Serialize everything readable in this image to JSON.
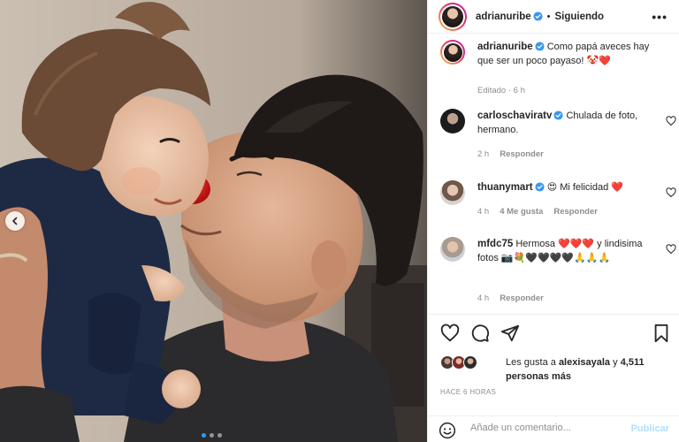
{
  "post": {
    "author": "adrianuribe",
    "follow_state": "Siguiendo",
    "bullet": "•",
    "more": "•••"
  },
  "caption": {
    "username": "adrianuribe",
    "text": "Como papá aveces hay que ser un poco payaso! 🤡❤️",
    "meta": "Editado · 6 h"
  },
  "comments": [
    {
      "username": "carloschavira​tv",
      "text": "Chulada de foto, hermano.",
      "time": "2 h",
      "likes": "",
      "reply": "Responder"
    },
    {
      "username": "thuanymart",
      "text": "😍 Mi felicidad ❤️",
      "time": "4 h",
      "likes": "4 Me gusta",
      "reply": "Responder"
    },
    {
      "username": "mfdc75",
      "text": "Hermosa ❤️❤️❤️ y lindisima fotos 📷💐🖤🖤🖤🖤🙏🙏🙏",
      "time": "4 h",
      "likes": "",
      "reply": "Responder"
    }
  ],
  "likes": {
    "prefix": "Les gusta a",
    "user": "alexisayala",
    "connector": "y",
    "others": "4,511 personas más"
  },
  "time_ago": "HACE 6 HORAS",
  "add_comment": {
    "placeholder": "Añade un comentario...",
    "publish": "Publicar"
  },
  "colors": {
    "verified": "#3897f0",
    "heart_red": "#ed4956",
    "accent": "#3897f0"
  },
  "icons": [
    "heart-icon",
    "comment-icon",
    "share-icon",
    "bookmark-icon",
    "emoji-icon",
    "verified-icon",
    "more-icon",
    "chevron-left-icon"
  ],
  "carousel": {
    "count": 3,
    "active": 1
  }
}
